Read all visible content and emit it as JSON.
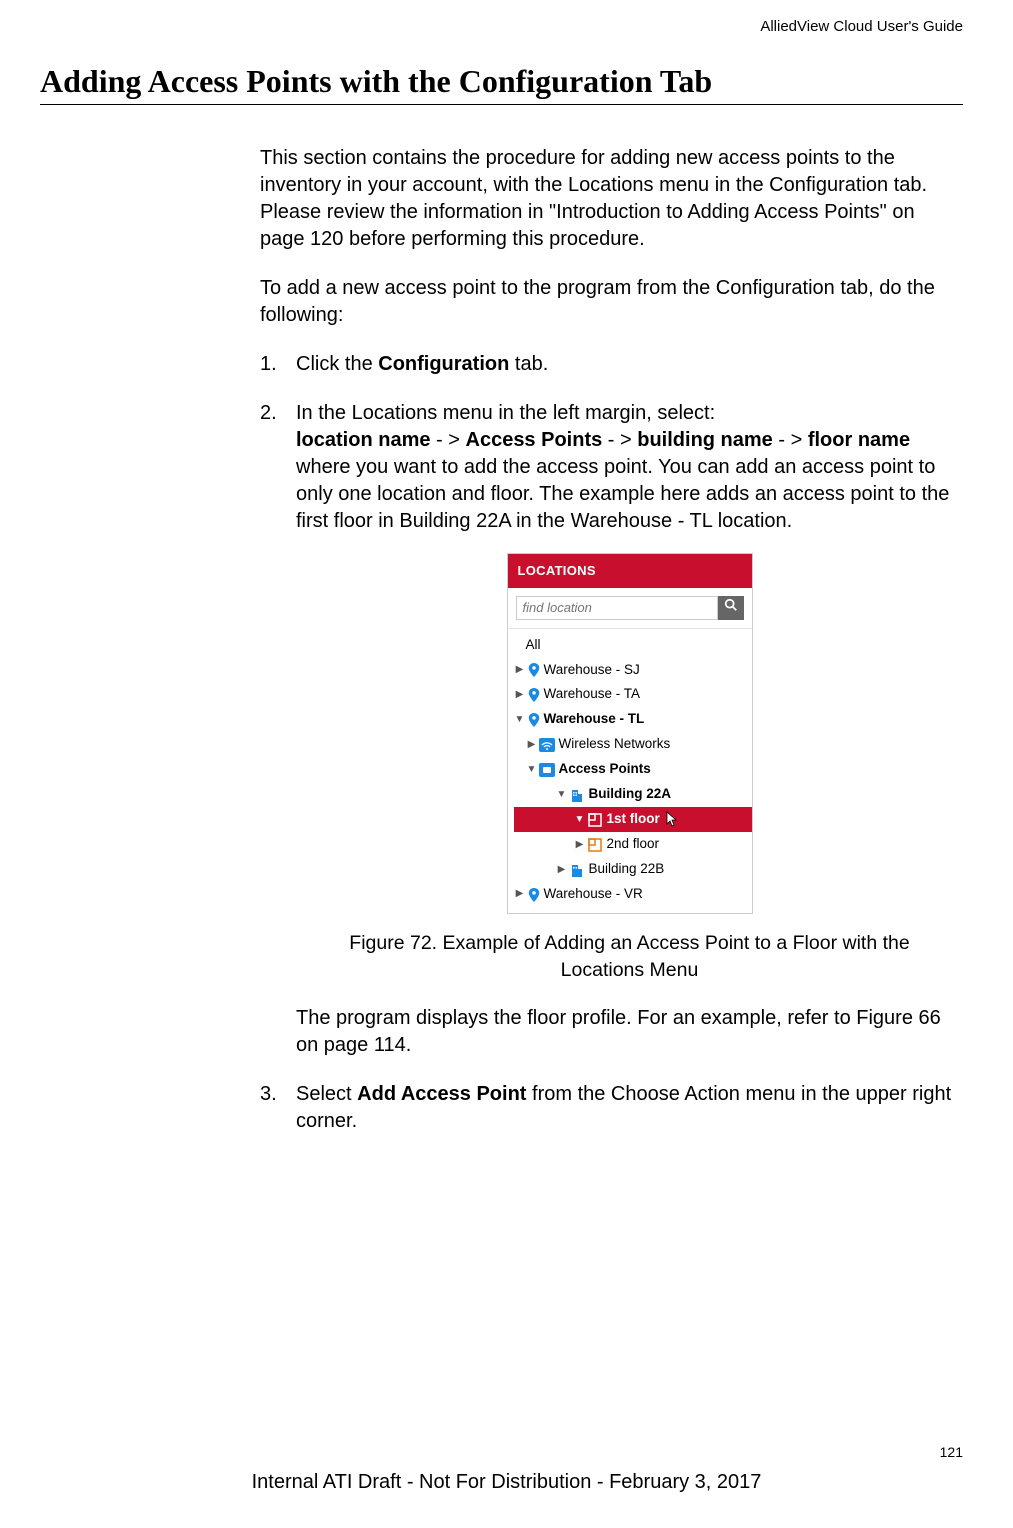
{
  "header": {
    "doc_title": "AlliedView Cloud User's Guide"
  },
  "title": "Adding Access Points with the Configuration Tab",
  "intro_para": "This section contains the procedure for adding new access points to the inventory in your account, with the Locations menu in the Configuration tab. Please review the information in \"Introduction to Adding Access Points\" on page 120 before performing this procedure.",
  "lead_para": "To add a new access point to the program from the Configuration tab, do the following:",
  "steps": {
    "s1_num": "1.",
    "s1_a": "Click the ",
    "s1_b": "Configuration",
    "s1_c": " tab.",
    "s2_num": "2.",
    "s2_line1": "In the Locations menu in the left margin, select:",
    "s2_lname": "location name",
    "s2_sep1": " - > ",
    "s2_ap": "Access Points",
    "s2_sep2": " - > ",
    "s2_bld": "building name",
    "s2_sep3": " - > ",
    "s2_flr": "floor name",
    "s2_tail": "where you want to add the access point. You can add an access point to only one location and floor. The example here adds an access point to the first floor in Building 22A in the Warehouse - TL location.",
    "s3_num": "3.",
    "s3_a": "Select ",
    "s3_b": "Add Access Point",
    "s3_c": " from the Choose Action menu in the upper right corner."
  },
  "locations": {
    "header": "LOCATIONS",
    "search_placeholder": "find location",
    "items": {
      "all": "All",
      "sj": "Warehouse - SJ",
      "ta": "Warehouse - TA",
      "tl": "Warehouse - TL",
      "wireless": "Wireless Networks",
      "ap": "Access Points",
      "b22a": "Building 22A",
      "f1": "1st floor",
      "f2": "2nd floor",
      "b22b": "Building 22B",
      "vr": "Warehouse - VR"
    }
  },
  "figure_caption": "Figure 72. Example of Adding an Access Point to a Floor with the Locations Menu",
  "after_fig": "The program displays the floor profile. For an example, refer to Figure 66 on page 114.",
  "page_num": "121",
  "footer": "Internal ATI Draft - Not For Distribution - February 3, 2017"
}
